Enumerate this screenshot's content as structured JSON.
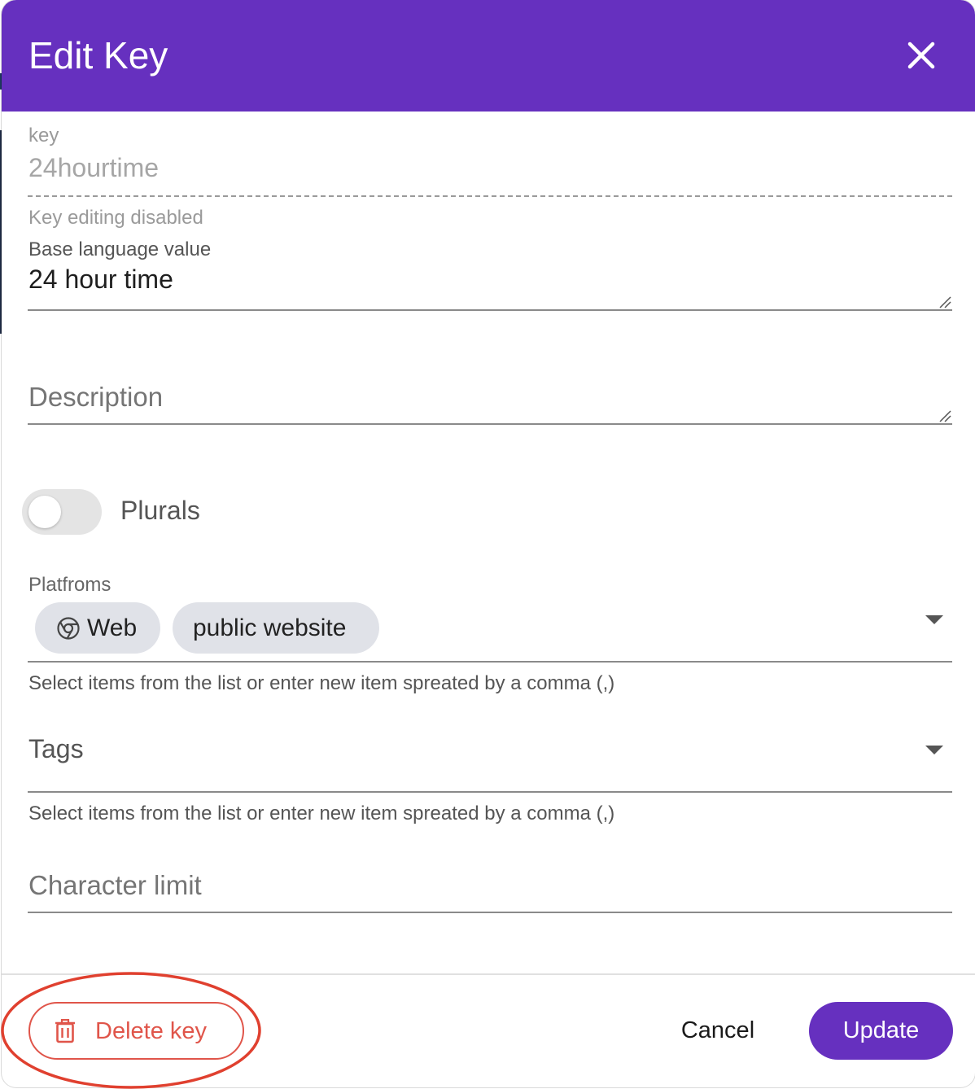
{
  "dialog": {
    "title": "Edit Key",
    "header_color": "#6630bf"
  },
  "key_field": {
    "label": "key",
    "value": "24hourtime",
    "helper": "Key editing disabled",
    "disabled": true
  },
  "base_language_field": {
    "label": "Base language value",
    "value": "24 hour time"
  },
  "description_field": {
    "placeholder": "Description",
    "value": ""
  },
  "plurals_toggle": {
    "label": "Plurals",
    "checked": false
  },
  "platforms_field": {
    "label": "Platfroms",
    "chips": [
      {
        "label": "Web",
        "icon": "chrome-icon"
      },
      {
        "label": "public website"
      }
    ],
    "helper": "Select items from the list or enter new item spreated by a comma (,)"
  },
  "tags_field": {
    "placeholder": "Tags",
    "helper": "Select items from the list or enter new item spreated by a comma (,)"
  },
  "character_limit_field": {
    "placeholder": "Character limit",
    "value": ""
  },
  "footer": {
    "delete_label": "Delete key",
    "cancel_label": "Cancel",
    "update_label": "Update",
    "delete_color": "#e0554a",
    "highlight_color": "#e0402f"
  },
  "icons": {
    "close": "close-icon",
    "trash": "trash-icon",
    "dropdown": "chevron-down-icon",
    "resize": "resize-grip-icon"
  }
}
